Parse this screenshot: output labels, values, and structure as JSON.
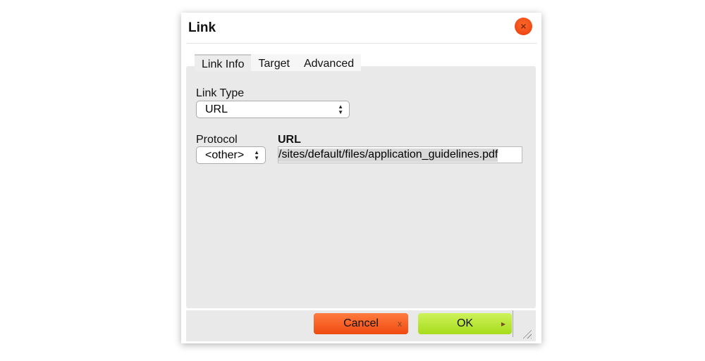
{
  "dialog": {
    "title": "Link",
    "close_icon": "close-icon"
  },
  "tabs": [
    {
      "label": "Link Info",
      "active": true
    },
    {
      "label": "Target"
    },
    {
      "label": "Advanced"
    }
  ],
  "form": {
    "link_type_label": "Link Type",
    "link_type_value": "URL",
    "protocol_label": "Protocol",
    "protocol_value": "<other>",
    "url_label": "URL",
    "url_value": "/sites/default/files/application_guidelines.pdf"
  },
  "footer": {
    "cancel_label": "Cancel",
    "cancel_icon": "x",
    "ok_label": "OK",
    "ok_icon": "▸"
  },
  "colors": {
    "cancel": "#f15a1c",
    "ok": "#b8e63a",
    "close": "#f04a14"
  }
}
